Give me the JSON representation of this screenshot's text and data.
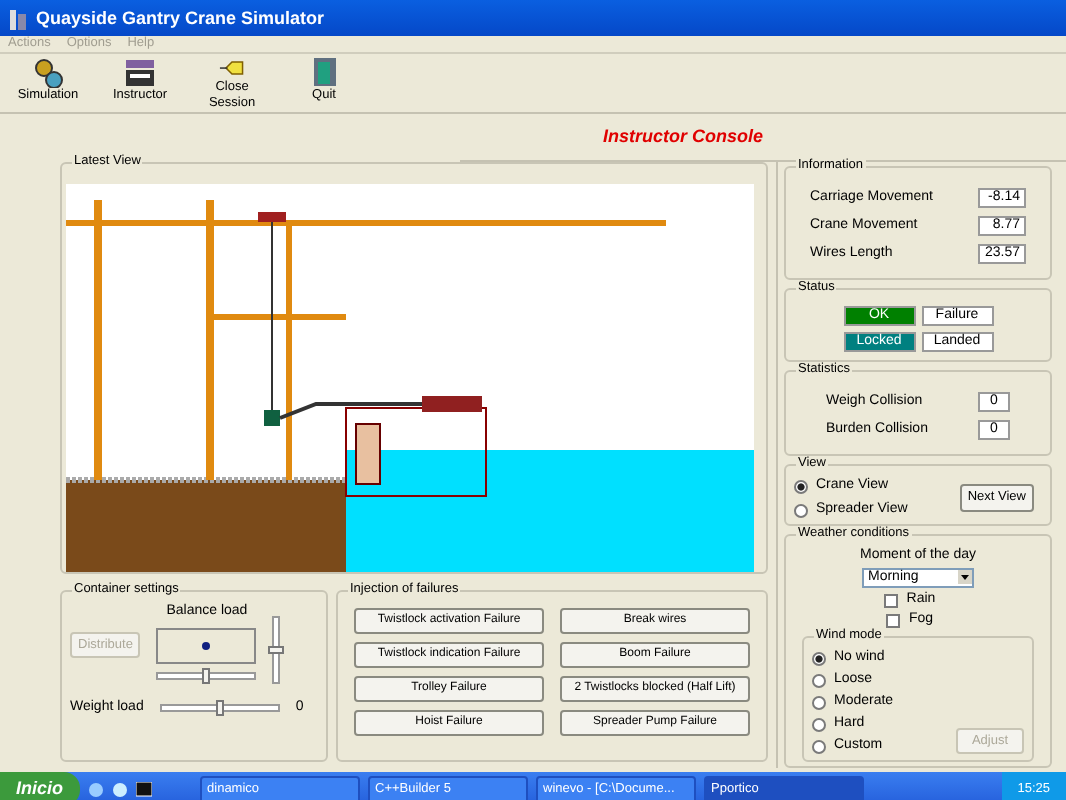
{
  "window": {
    "title": "Quayside Gantry Crane Simulator"
  },
  "menu": [
    {
      "label": "Actions",
      "disabled": true
    },
    {
      "label": "Options",
      "disabled": true
    },
    {
      "label": "Help",
      "disabled": true
    }
  ],
  "toolbar": [
    {
      "label": "Simulation",
      "kind": "gears"
    },
    {
      "label": "Instructor",
      "kind": "console"
    },
    {
      "label": "Close Session",
      "kind": "tag"
    },
    {
      "label": "Quit",
      "kind": "door"
    }
  ],
  "heading": "Instructor Console",
  "latest_view": {
    "title": "Latest View"
  },
  "information": {
    "title": "Information",
    "rows": [
      {
        "label": "Carriage Movement",
        "value": "-8.14"
      },
      {
        "label": "Crane Movement",
        "value": "8.77"
      },
      {
        "label": "Wires Length",
        "value": "23.57"
      }
    ]
  },
  "status": {
    "title": "Status",
    "items": [
      {
        "label": "OK",
        "color": "#008000"
      },
      {
        "label": "Failure",
        "color": "#ffffff"
      },
      {
        "label": "Locked",
        "color": "#008080"
      },
      {
        "label": "Landed",
        "color": "#ffffff"
      }
    ]
  },
  "statistics": {
    "title": "Statistics",
    "rows": [
      {
        "label": "Weigh Collision",
        "value": "0"
      },
      {
        "label": "Burden Collision",
        "value": "0"
      }
    ]
  },
  "view": {
    "title": "View",
    "options": [
      {
        "label": "Crane View",
        "selected": true
      },
      {
        "label": "Spreader View",
        "selected": false
      }
    ],
    "button": "Next View"
  },
  "weather": {
    "title": "Weather conditions",
    "moment_label": "Moment of the day",
    "moment_value": "Morning",
    "checks": [
      {
        "label": "Rain",
        "checked": false
      },
      {
        "label": "Fog",
        "checked": false
      }
    ],
    "wind": {
      "title": "Wind mode",
      "options": [
        {
          "label": "No wind",
          "selected": true
        },
        {
          "label": "Loose",
          "selected": false
        },
        {
          "label": "Moderate",
          "selected": false
        },
        {
          "label": "Hard",
          "selected": false
        },
        {
          "label": "Custom",
          "selected": false
        }
      ],
      "button": {
        "label": "Adjust",
        "disabled": true
      }
    }
  },
  "container_settings": {
    "title": "Container settings",
    "balance_label": "Balance load",
    "distribute": {
      "label": "Distribute",
      "disabled": true
    },
    "balance_h": {
      "level": 0.5
    },
    "balance_v": {
      "level": 0.5
    },
    "weight_label": "Weight load",
    "weight": {
      "level": 0.5
    },
    "weight_value": "0"
  },
  "failures": {
    "title": "Injection of failures",
    "buttons": [
      "Twistlock activation Failure",
      "Break wires",
      "Twistlock indication Failure",
      "Boom Failure",
      "Trolley Failure",
      "2 Twistlocks blocked (Half Lift)",
      "Hoist Failure",
      "Spreader Pump Failure"
    ]
  },
  "taskbar": {
    "start": "Inicio",
    "tasks": [
      {
        "label": "dinamico",
        "selected": false
      },
      {
        "label": "C++Builder 5",
        "selected": false
      },
      {
        "label": "winevo - [C:\\Docume...",
        "selected": false
      },
      {
        "label": "Pportico",
        "selected": true
      }
    ],
    "clock": "15:25"
  }
}
